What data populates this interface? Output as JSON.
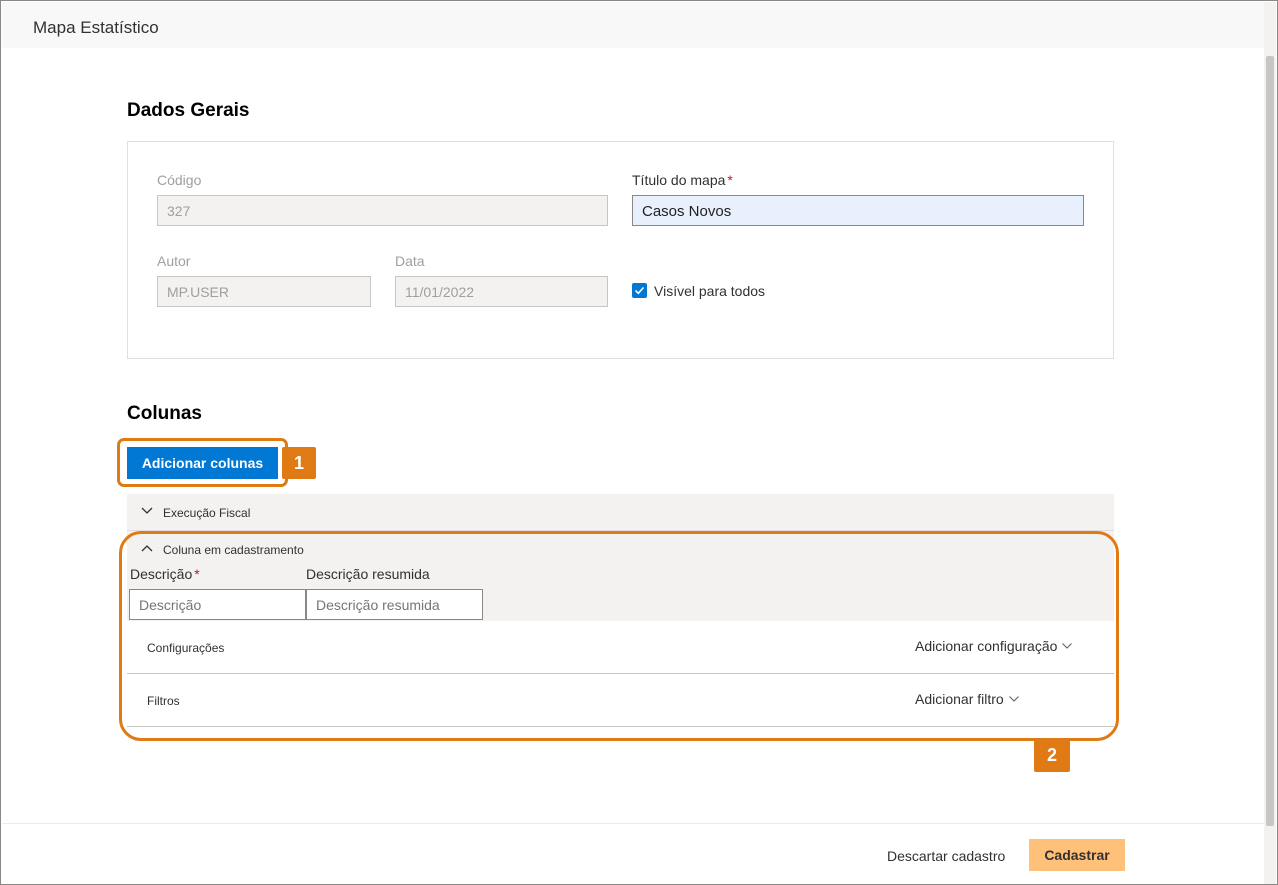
{
  "window": {
    "title": "Mapa Estatístico"
  },
  "dados_gerais": {
    "heading": "Dados Gerais",
    "codigo": {
      "label": "Código",
      "value": "327"
    },
    "titulo": {
      "label": "Título do mapa",
      "required_mark": "*",
      "value": "Casos Novos"
    },
    "autor": {
      "label": "Autor",
      "value": "MP.USER"
    },
    "data": {
      "label": "Data",
      "value": "11/01/2022"
    },
    "visivel": {
      "label": "Visível para todos",
      "checked": true
    }
  },
  "colunas": {
    "heading": "Colunas",
    "add_button": "Adicionar colunas",
    "groups": [
      {
        "label": "Execução Fiscal",
        "expanded": false
      },
      {
        "label": "Coluna em cadastramento",
        "expanded": true
      }
    ],
    "descricao": {
      "label": "Descrição",
      "required_mark": "*",
      "placeholder": "Descrição"
    },
    "descricao_resumida": {
      "label": "Descrição resumida",
      "placeholder": "Descrição resumida"
    },
    "configuracoes": {
      "label": "Configurações",
      "action": "Adicionar configuração"
    },
    "filtros": {
      "label": "Filtros",
      "action": "Adicionar filtro"
    }
  },
  "callouts": {
    "one": "1",
    "two": "2",
    "color": "#e07a14"
  },
  "footer": {
    "discard": "Descartar cadastro",
    "submit": "Cadastrar"
  },
  "colors": {
    "primary": "#0078d4",
    "submit": "#ffc07a"
  }
}
